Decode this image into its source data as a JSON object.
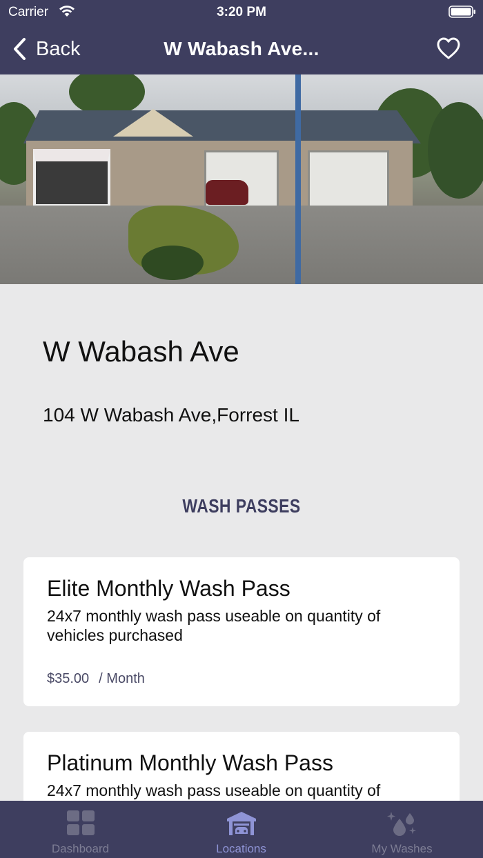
{
  "status_bar": {
    "carrier": "Carrier",
    "time": "3:20 PM"
  },
  "nav": {
    "back_label": "Back",
    "title": "W Wabash Ave..."
  },
  "location": {
    "name": "W Wabash Ave",
    "address": "104 W Wabash Ave,Forrest IL"
  },
  "wash_passes": {
    "section_title": "WASH PASSES",
    "items": [
      {
        "title": "Elite Monthly Wash Pass",
        "description": "24x7 monthly wash pass useable on quantity of vehicles purchased",
        "price": "$35.00",
        "period": "/ Month"
      },
      {
        "title": "Platinum Monthly Wash Pass",
        "description": "24x7 monthly wash pass useable on quantity of",
        "price": "",
        "period": ""
      }
    ]
  },
  "tabbar": {
    "active": "Locations",
    "tabs": [
      {
        "label": "Dashboard",
        "icon": "grid-icon"
      },
      {
        "label": "Locations",
        "icon": "garage-icon"
      },
      {
        "label": "My Washes",
        "icon": "droplets-icon"
      }
    ]
  },
  "colors": {
    "nav_bg": "#3e3e5f",
    "page_bg": "#e9e9ea",
    "accent": "#8f94d6",
    "inactive": "#7d7d94"
  }
}
